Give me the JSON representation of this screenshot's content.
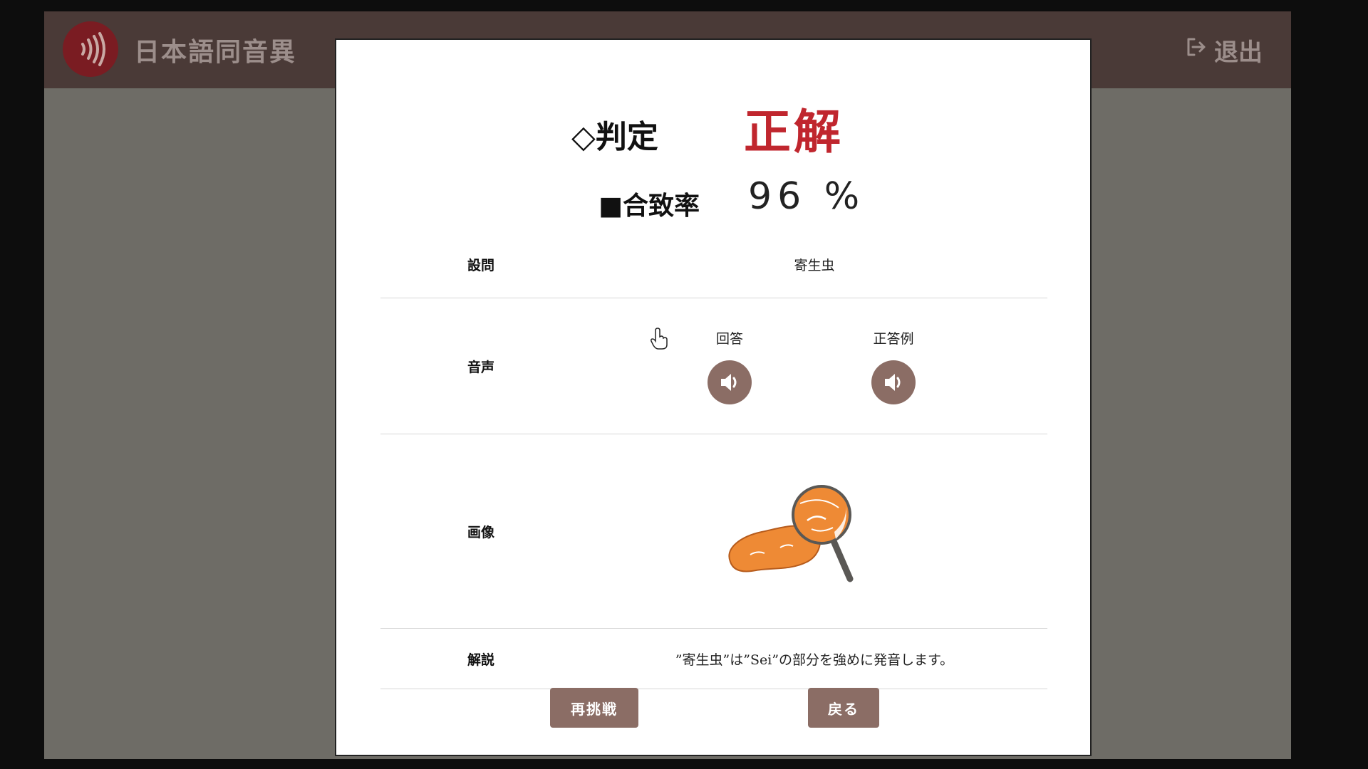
{
  "header": {
    "app_title": "日本語同音異",
    "exit_label": "退出"
  },
  "result": {
    "judgement_label": "◇判定",
    "judgement_value": "正解",
    "match_rate_label": "■合致率",
    "match_rate_value": "96 %"
  },
  "table": {
    "question_label": "設問",
    "question_value": "寄生虫",
    "audio_label": "音声",
    "audio_answer_label": "回答",
    "audio_correct_label": "正答例",
    "image_label": "画像",
    "explanation_label": "解説",
    "explanation_value": "”寄生虫”は”Sei”の部分を強めに発音します。"
  },
  "buttons": {
    "retry": "再挑戦",
    "back": "戻る"
  },
  "colors": {
    "header_bg": "#4a3a37",
    "accent_button": "#8b6d65",
    "correct_red": "#c0262e",
    "logo_red": "#7a1c22"
  },
  "icons": {
    "logo": "sound-waves-icon",
    "exit": "logout-icon",
    "play": "speaker-icon",
    "image": "salmon-magnifier-illustration"
  }
}
